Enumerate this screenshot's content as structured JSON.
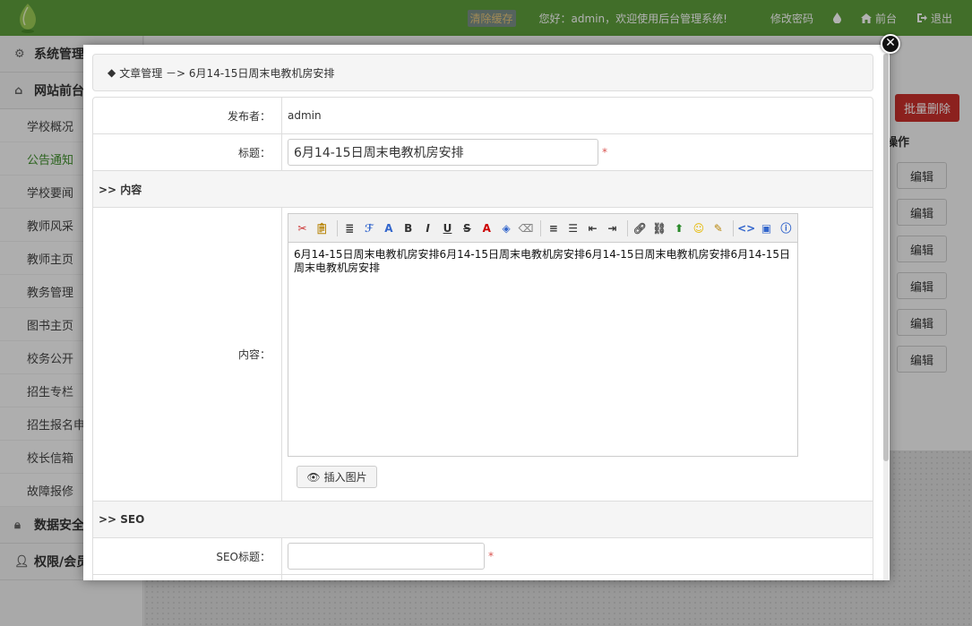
{
  "topbar": {
    "clear_cache": "清除缓存",
    "greeting": "您好：admin，欢迎使用后台管理系统!",
    "change_password": "修改密码",
    "frontend": "前台",
    "logout": "退出",
    "bg_color": "#5d9e3b"
  },
  "sidebar": {
    "sections": {
      "system": "系统管理",
      "website": "网站前台",
      "data_security": "数据安全",
      "permission": "权限/会员"
    },
    "items": [
      "学校概况",
      "公告通知",
      "学校要闻",
      "教师风采",
      "教师主页",
      "教务管理",
      "图书主页",
      "校务公开",
      "招生专栏",
      "招生报名申请",
      "校长信箱",
      "故障报修"
    ],
    "active_index": 1
  },
  "background": {
    "bulk_delete": "批量删除",
    "op_header": "操作",
    "edit_label": "编辑"
  },
  "modal": {
    "breadcrumb": "文章管理 －> 6月14-15日周末电教机房安排",
    "publisher_label": "发布者：",
    "publisher_value": "admin",
    "title_label": "标题：",
    "title_value": "6月14-15日周末电教机房安排",
    "required_mark": "*",
    "content_section": ">> 内容",
    "content_label": "内容：",
    "content_text": "6月14-15日周末电教机房安排6月14-15日周末电教机房安排6月14-15日周末电教机房安排6月14-15日周末电教机房安排",
    "insert_image": "插入图片",
    "seo_section": ">> SEO",
    "seo_title_label": "SEO标题：",
    "seo_title_value": ""
  },
  "colors": {
    "accent_green": "#3f8f2b",
    "danger_red": "#c9302c"
  }
}
